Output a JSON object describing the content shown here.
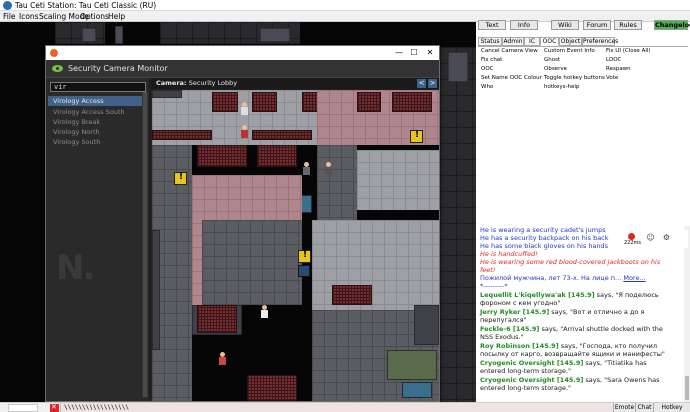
{
  "window": {
    "title": "Tau Ceti Station: Tau Ceti Classic (RU)"
  },
  "menu": [
    "File",
    "Icons",
    "Scaling Mode",
    "Options",
    "Help"
  ],
  "monitor": {
    "title": "Security Camera Monitor",
    "search_value": "vir",
    "cameras": [
      {
        "label": "Virology Access",
        "active": true
      },
      {
        "label": "Virology Access South",
        "active": false
      },
      {
        "label": "Virology Break",
        "active": false
      },
      {
        "label": "Virology North",
        "active": false
      },
      {
        "label": "Virology South",
        "active": false
      }
    ],
    "camera_label": "Camera:",
    "camera_name": "Security Lobby",
    "prev": "<",
    "next": ">",
    "watermark": "N.",
    "controls": {
      "minimize": "—",
      "maximize": "☐",
      "close": "✕"
    }
  },
  "top_buttons": [
    "Text",
    "Info",
    "Wiki",
    "Forum",
    "Rules",
    "Changelog"
  ],
  "tabs": [
    "Status",
    "Admin",
    "IC",
    "OOC",
    "Object",
    "Preferences"
  ],
  "selected_tab": "OOC",
  "verbs": [
    [
      "Cancel Camera View",
      "Custom Event Info",
      "Fix UI (Close All)"
    ],
    [
      "Fix chat",
      "Ghost",
      "LOOC"
    ],
    [
      "OOC",
      "Observe",
      "Respawn"
    ],
    [
      "Set Name OOC Colour",
      "Toggle hotkey buttons",
      "Vote"
    ],
    [
      "Who",
      "hotkeys-help",
      ""
    ]
  ],
  "overlay": {
    "ping": "222ms"
  },
  "chat": [
    {
      "cls": "c-blue",
      "text": "He is wearing a security cadet's jumps"
    },
    {
      "cls": "c-blue",
      "text": "He has a security backpack on his back"
    },
    {
      "cls": "c-blue",
      "text": "He has some black gloves on his hands"
    },
    {
      "cls": "c-red",
      "text": "He is handcuffed!"
    },
    {
      "cls": "c-red",
      "text": "He is wearing some red blood-covered jackboots on his"
    },
    {
      "cls": "c-red",
      "text": "feet!"
    },
    {
      "cls": "c-blue",
      "text": "Пожилой мужчина, лет 73-х. На лице п...",
      "more": "More..."
    },
    {
      "cls": "c-blue",
      "text": "*---------*"
    },
    {
      "name": "Lequellit L'kiqellywa'ak [145.9]",
      "text": " says, \"Я поделюсь"
    },
    {
      "cls": "c-green",
      "text": "фороном с кем угодно\""
    },
    {
      "name": "Jerry Ryker [145.9]",
      "text": " says, \"Вот и отлично а до я"
    },
    {
      "cls": "c-green",
      "text": "перепугался\""
    },
    {
      "name": "Feckle-6 [145.9]",
      "text": " says, \"Arrival shuttle docked with the"
    },
    {
      "cls": "c-green",
      "text": "NSS Exodus.\""
    },
    {
      "name": "Roy Robinson [145.9]",
      "text": " says, \"Господа, кто получил"
    },
    {
      "cls": "c-green",
      "text": "посылку от карго, возвращайте ящики и манифесты\""
    },
    {
      "name": "Cryogenic Oversight [145.9]",
      "text": " says, \"Titiatika has"
    },
    {
      "cls": "c-green",
      "text": "entered long-term storage.\""
    },
    {
      "name": "Cryogenic Oversight [145.9]",
      "text": " says, \"Sara Owens has"
    },
    {
      "cls": "c-green",
      "text": "entered long-term storage.\""
    }
  ],
  "input_value": "\\\\\\\\\\\\\\\\\\\\\\\\\\\\\\\\\\\\",
  "bottom_buttons": [
    "Emote",
    "Chat",
    "Hotkey Toggle"
  ]
}
